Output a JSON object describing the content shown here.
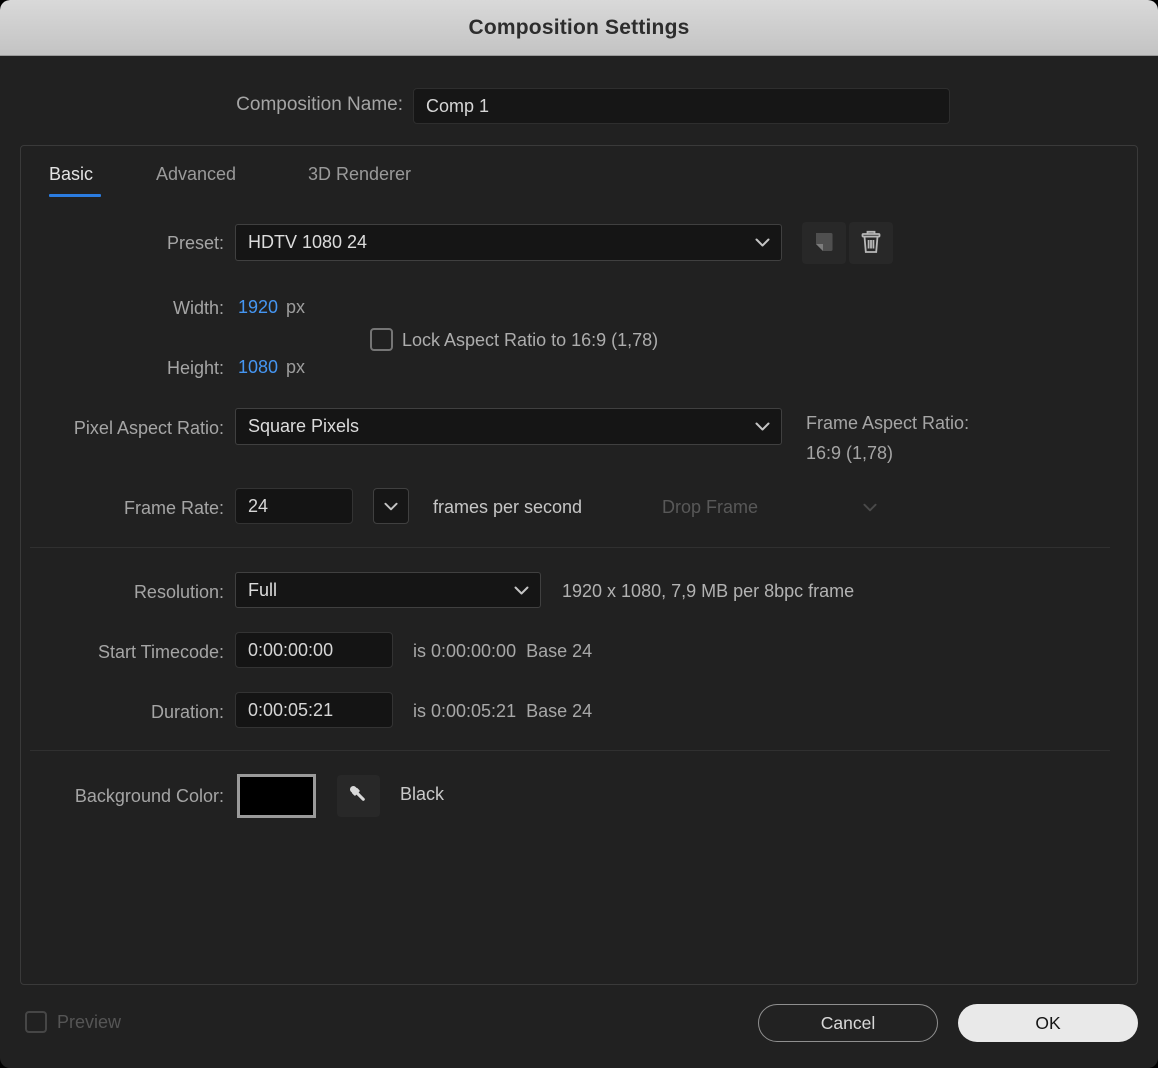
{
  "dialog": {
    "title": "Composition Settings",
    "comp_name_label": "Composition Name:",
    "comp_name_value": "Comp 1"
  },
  "tabs": [
    {
      "label": "Basic",
      "active": true
    },
    {
      "label": "Advanced",
      "active": false
    },
    {
      "label": "3D Renderer",
      "active": false
    }
  ],
  "basic": {
    "preset_label": "Preset:",
    "preset_value": "HDTV 1080 24",
    "width_label": "Width:",
    "width_value": "1920",
    "width_unit": "px",
    "height_label": "Height:",
    "height_value": "1080",
    "height_unit": "px",
    "lock_aspect_label": "Lock Aspect Ratio to 16:9 (1,78)",
    "pixel_aspect_ratio_label": "Pixel Aspect Ratio:",
    "pixel_aspect_ratio_value": "Square Pixels",
    "frame_aspect_ratio_label": "Frame Aspect Ratio:",
    "frame_aspect_ratio_value": "16:9 (1,78)",
    "frame_rate_label": "Frame Rate:",
    "frame_rate_value": "24",
    "frames_per_second_label": "frames per second",
    "drop_frame_value": "Drop Frame",
    "resolution_label": "Resolution:",
    "resolution_value": "Full",
    "resolution_info": "1920 x 1080, 7,9 MB per 8bpc frame",
    "start_timecode_label": "Start Timecode:",
    "start_timecode_value": "0:00:00:00",
    "start_timecode_info": "is 0:00:00:00  Base 24",
    "duration_label": "Duration:",
    "duration_value": "0:00:05:21",
    "duration_info": "is 0:00:05:21  Base 24",
    "background_color_label": "Background Color:",
    "background_color_name": "Black",
    "background_color_hex": "#000000"
  },
  "footer": {
    "preview_label": "Preview",
    "cancel_label": "Cancel",
    "ok_label": "OK"
  },
  "colors": {
    "value_blue": "#4596f2",
    "tab_underline_blue": "#2b7ce0",
    "titlebar_gray": "#cdcdcd",
    "dialog_background": "#212121"
  }
}
